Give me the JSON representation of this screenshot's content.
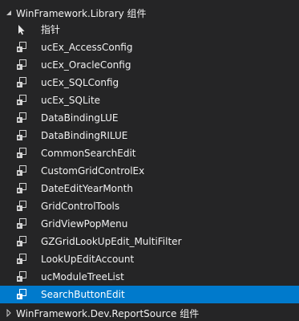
{
  "group": {
    "title": "WinFramework.Library 组件",
    "expanded_icon": "chevron-down-icon"
  },
  "items": [
    {
      "label": "指针",
      "icon": "pointer-icon",
      "selected": false
    },
    {
      "label": "ucEx_AccessConfig",
      "icon": "user-control-icon",
      "selected": false
    },
    {
      "label": "ucEx_OracleConfig",
      "icon": "user-control-icon",
      "selected": false
    },
    {
      "label": "ucEx_SQLConfig",
      "icon": "user-control-icon",
      "selected": false
    },
    {
      "label": "ucEx_SQLite",
      "icon": "user-control-icon",
      "selected": false
    },
    {
      "label": "DataBindingLUE",
      "icon": "user-control-icon",
      "selected": false
    },
    {
      "label": "DataBindingRILUE",
      "icon": "user-control-icon",
      "selected": false
    },
    {
      "label": "CommonSearchEdit",
      "icon": "user-control-icon",
      "selected": false
    },
    {
      "label": "CustomGridControlEx",
      "icon": "user-control-icon",
      "selected": false
    },
    {
      "label": "DateEditYearMonth",
      "icon": "user-control-icon",
      "selected": false
    },
    {
      "label": "GridControlTools",
      "icon": "user-control-icon",
      "selected": false
    },
    {
      "label": "GridViewPopMenu",
      "icon": "user-control-icon",
      "selected": false
    },
    {
      "label": "GZGridLookUpEdit_MultiFilter",
      "icon": "user-control-icon",
      "selected": false
    },
    {
      "label": "LookUpEditAccount",
      "icon": "user-control-icon",
      "selected": false
    },
    {
      "label": "ucModuleTreeList",
      "icon": "user-control-icon",
      "selected": false
    },
    {
      "label": "SearchButtonEdit",
      "icon": "user-control-icon",
      "selected": true
    }
  ],
  "next_group": {
    "title": "WinFramework.Dev.ReportSource 组件",
    "collapsed_icon": "chevron-right-icon"
  },
  "colors": {
    "background": "#252526",
    "selection": "#007acc",
    "text": "#f1f1f1"
  }
}
